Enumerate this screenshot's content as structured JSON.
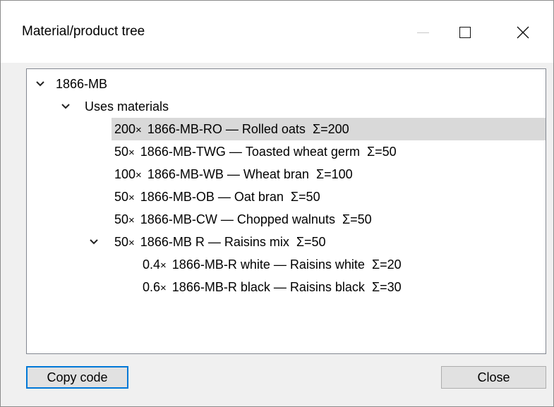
{
  "window": {
    "title": "Material/product tree"
  },
  "tree": {
    "root": {
      "label": "1866-MB",
      "expanded": true
    },
    "group": {
      "label": "Uses materials",
      "expanded": true
    },
    "items": [
      {
        "qty": "200",
        "code": "1866-MB-RO",
        "name": "Rolled oats",
        "sum": "Σ=200",
        "selected": true
      },
      {
        "qty": "50",
        "code": "1866-MB-TWG",
        "name": "Toasted wheat germ",
        "sum": "Σ=50"
      },
      {
        "qty": "100",
        "code": "1866-MB-WB",
        "name": "Wheat bran",
        "sum": "Σ=100"
      },
      {
        "qty": "50",
        "code": "1866-MB-OB",
        "name": "Oat bran",
        "sum": "Σ=50"
      },
      {
        "qty": "50",
        "code": "1866-MB-CW",
        "name": "Chopped walnuts",
        "sum": "Σ=50"
      },
      {
        "qty": "50",
        "code": "1866-MB R",
        "name": "Raisins mix",
        "sum": "Σ=50",
        "expanded": true
      },
      {
        "qty": "0.4",
        "code": "1866-MB-R white",
        "name": "Raisins white",
        "sum": "Σ=20"
      },
      {
        "qty": "0.6",
        "code": "1866-MB-R black",
        "name": "Raisins black",
        "sum": "Σ=30"
      }
    ]
  },
  "buttons": {
    "copy_label": "Copy code",
    "close_label": "Close"
  },
  "colors": {
    "selection": "#d9d9d9",
    "focus_border": "#0078d7"
  }
}
